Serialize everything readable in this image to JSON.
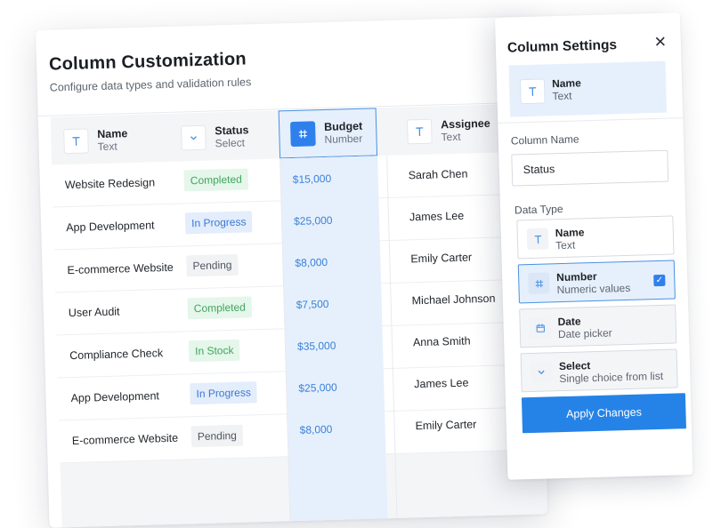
{
  "header": {
    "title": "Column Customization",
    "subtitle": "Configure data types and validation rules"
  },
  "columns": [
    {
      "name": "Name",
      "type": "Text",
      "icon": "text-icon"
    },
    {
      "name": "Status",
      "type": "Select",
      "icon": "chevron-down-icon"
    },
    {
      "name": "Budget",
      "type": "Number",
      "icon": "hash-icon"
    },
    {
      "name": "Assignee",
      "type": "Text",
      "icon": "text-icon"
    }
  ],
  "rows": [
    {
      "name": "Website Redesign",
      "status": "Completed",
      "budget": "$15,000",
      "assignee": "Sarah Chen"
    },
    {
      "name": "App Development",
      "status": "In Progress",
      "budget": "$25,000",
      "assignee": "James Lee"
    },
    {
      "name": "E-commerce Website",
      "status": "Pending",
      "budget": "$8,000",
      "assignee": "Emily Carter"
    },
    {
      "name": "User Audit",
      "status": "Completed",
      "budget": "$7,500",
      "assignee": "Michael Johnson"
    },
    {
      "name": "Compliance Check",
      "status": "In Stock",
      "budget": "$35,000",
      "assignee": "Anna Smith"
    },
    {
      "name": "App Development",
      "status": "In Progress",
      "budget": "$25,000",
      "assignee": "James Lee"
    },
    {
      "name": "E-commerce Website",
      "status": "Pending",
      "budget": "$8,000",
      "assignee": "Emily Carter"
    }
  ],
  "panel": {
    "title": "Column Settings",
    "close_glyph": "✕",
    "selected_column": {
      "name": "Name",
      "type": "Text"
    },
    "column_name_label": "Column Name",
    "column_name_value": "Status",
    "data_type_label": "Data Type",
    "types": [
      {
        "name": "Name",
        "desc": "Text",
        "icon": "text-icon"
      },
      {
        "name": "Number",
        "desc": "Numeric values",
        "icon": "hash-icon"
      },
      {
        "name": "Date",
        "desc": "Date picker",
        "icon": "calendar-icon"
      },
      {
        "name": "Select",
        "desc": "Single choice from list",
        "icon": "chevron-down-icon"
      }
    ],
    "apply_label": "Apply Changes"
  },
  "colors": {
    "accent": "#2f80ed",
    "completed": "#3fa55f",
    "in_progress": "#3b78d6"
  }
}
